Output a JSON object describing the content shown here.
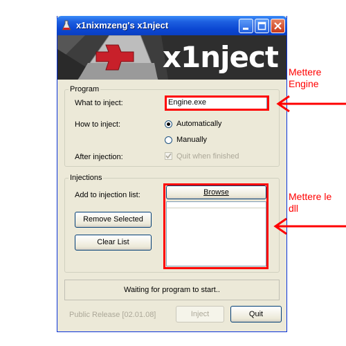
{
  "window": {
    "title": "x1nixmzeng's x1nject",
    "banner_title": "x1nject"
  },
  "program_group": {
    "legend": "Program",
    "what_label": "What to inject:",
    "what_value": "Engine.exe",
    "how_label": "How to inject:",
    "auto_label": "Automatically",
    "manual_label": "Manually",
    "how_selected": "Automatically",
    "after_label": "After injection:",
    "quit_when_finished_label": "Quit when finished",
    "quit_when_finished_checked": true
  },
  "injections_group": {
    "legend": "Injections",
    "add_label": "Add to injection list:",
    "browse_label": "Browse",
    "remove_label": "Remove Selected",
    "clear_label": "Clear List"
  },
  "status_text": "Waiting for program to start..",
  "footer": {
    "release_label": "Public Release [02.01.08]",
    "inject_label": "Inject",
    "quit_label": "Quit"
  },
  "annotations": {
    "engine_note_line1": "Mettere",
    "engine_note_line2": "Engine",
    "dll_note_line1": "Mettere le",
    "dll_note_line2": "dll"
  },
  "colors": {
    "annotation": "#ff0000",
    "titlebar": "#0b46d1",
    "window_bg": "#ece9d8"
  }
}
